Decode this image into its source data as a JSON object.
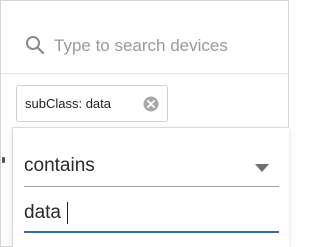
{
  "search": {
    "placeholder": "Type to search devices",
    "value": ""
  },
  "filter_chip": {
    "label": "subClass: data",
    "close_icon": "close-circle-icon"
  },
  "editor": {
    "operator": {
      "selected": "contains",
      "icon": "caret-down-icon"
    },
    "value": {
      "current": "data"
    }
  },
  "colors": {
    "accent": "#2e6bb3",
    "placeholder": "#9a9a9a",
    "border": "#d6d6d6"
  }
}
